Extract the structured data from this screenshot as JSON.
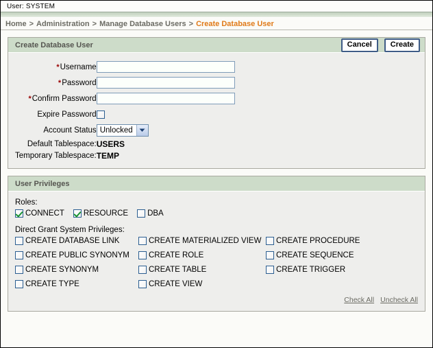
{
  "header": {
    "user_label": "User: SYSTEM"
  },
  "breadcrumb": {
    "separator": ">",
    "items": [
      {
        "label": "Home",
        "current": false
      },
      {
        "label": "Administration",
        "current": false
      },
      {
        "label": "Manage Database Users",
        "current": false
      },
      {
        "label": "Create Database User",
        "current": true
      }
    ]
  },
  "create_user_panel": {
    "title": "Create Database User",
    "cancel_label": "Cancel",
    "create_label": "Create",
    "fields": {
      "username": {
        "label": "Username",
        "value": "",
        "required_marker": "*"
      },
      "password": {
        "label": "Password",
        "value": "",
        "required_marker": "*"
      },
      "confirm_password": {
        "label": "Confirm Password",
        "value": "",
        "required_marker": "*"
      },
      "expire_password": {
        "label": "Expire Password",
        "checked": false
      },
      "account_status": {
        "label": "Account Status",
        "value": "Unlocked"
      },
      "default_tablespace": {
        "label": "Default Tablespace:",
        "value": "USERS"
      },
      "temporary_tablespace": {
        "label": "Temporary Tablespace:",
        "value": "TEMP"
      }
    }
  },
  "privileges_panel": {
    "title": "User Privileges",
    "roles_label": "Roles:",
    "roles": [
      {
        "label": "CONNECT",
        "checked": true
      },
      {
        "label": "RESOURCE",
        "checked": true
      },
      {
        "label": "DBA",
        "checked": false
      }
    ],
    "system_privileges_label": "Direct Grant System Privileges:",
    "system_privileges_rows": [
      [
        {
          "label": "CREATE DATABASE LINK",
          "checked": false
        },
        {
          "label": "CREATE MATERIALIZED VIEW",
          "checked": false
        },
        {
          "label": "CREATE PROCEDURE",
          "checked": false
        }
      ],
      [
        {
          "label": "CREATE PUBLIC SYNONYM",
          "checked": false
        },
        {
          "label": "CREATE ROLE",
          "checked": false
        },
        {
          "label": "CREATE SEQUENCE",
          "checked": false
        }
      ],
      [
        {
          "label": "CREATE SYNONYM",
          "checked": false
        },
        {
          "label": "CREATE TABLE",
          "checked": false
        },
        {
          "label": "CREATE TRIGGER",
          "checked": false
        }
      ],
      [
        {
          "label": "CREATE TYPE",
          "checked": false
        },
        {
          "label": "CREATE VIEW",
          "checked": false
        },
        {
          "label": "",
          "checked": false
        }
      ]
    ],
    "check_all_label": "Check All",
    "uncheck_all_label": "Uncheck All"
  },
  "colors": {
    "panel_header_green": "#cddcc9",
    "breadcrumb_gray": "#6b6b63",
    "breadcrumb_current_orange": "#e07a18",
    "required_red": "#990000",
    "button_border_blue": "#3f5c87",
    "checkbox_border_blue": "#2a5d90",
    "check_green": "#179431",
    "panel_bg": "#eeeeec"
  }
}
